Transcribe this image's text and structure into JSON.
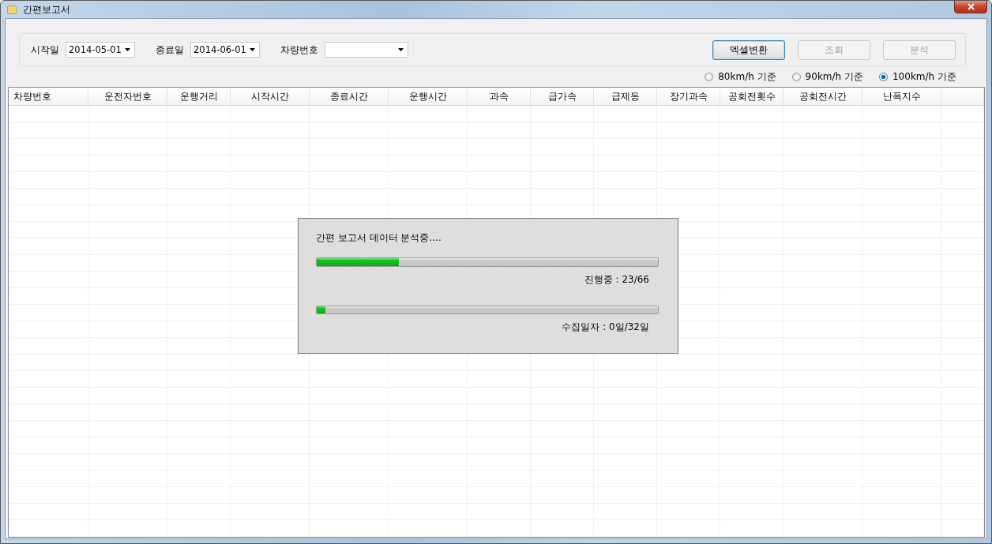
{
  "window": {
    "title": "간편보고서"
  },
  "filters": [
    {
      "label": "시작일",
      "value": "2014-05-01"
    },
    {
      "label": "종료일",
      "value": "2014-06-01"
    },
    {
      "label": "차량번호"
    }
  ],
  "buttons": [
    {
      "label": "엑셀변환",
      "disabled": false
    },
    {
      "label": "조회",
      "disabled": true
    },
    {
      "label": "분석",
      "disabled": true
    }
  ],
  "speed_options": [
    {
      "label": "80km/h 기준",
      "selected": false
    },
    {
      "label": "90km/h 기준",
      "selected": false
    },
    {
      "label": "100km/h 기준",
      "selected": true
    }
  ],
  "table": {
    "columns": [
      "차량번호",
      "운전자번호",
      "운행거리",
      "시작시간",
      "종료시간",
      "운행시간",
      "과속",
      "급가속",
      "급제동",
      "장기과속",
      "공회전횟수",
      "공회전시간",
      "난폭지수"
    ]
  },
  "progress_dialog": {
    "message": "간편 보고서 데이터 분석중....",
    "bars": [
      {
        "level": 0.24,
        "reading": "진행중 : 23/66"
      },
      {
        "level": 0.025,
        "reading": "수집일자 : 0일/32일"
      }
    ]
  }
}
